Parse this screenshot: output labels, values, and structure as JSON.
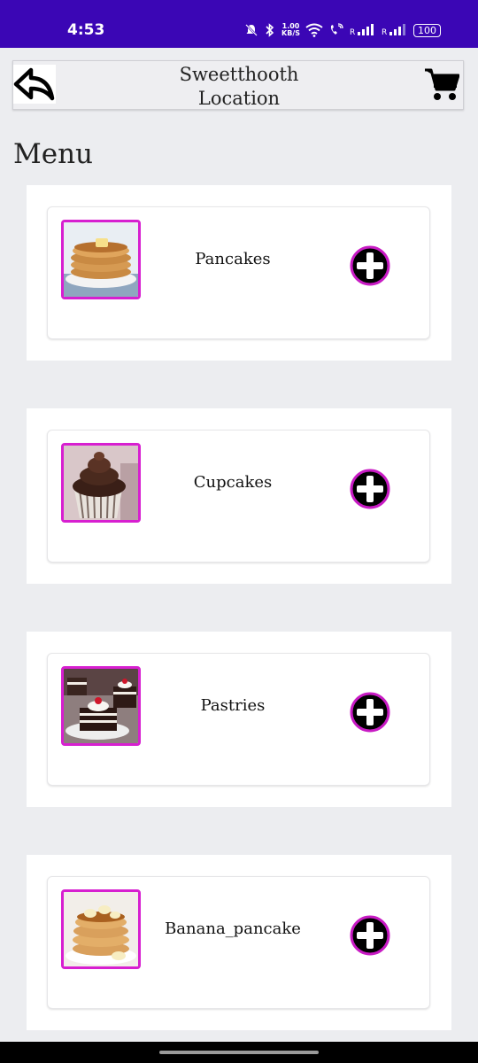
{
  "status_bar": {
    "time": "4:53",
    "net_speed_value": "1.00",
    "net_speed_unit": "KB/S",
    "battery": "100"
  },
  "header": {
    "title_line1": "Sweetthooth",
    "title_line2": "Location",
    "back_icon": "reply-arrow-icon",
    "cart_icon": "shopping-cart-icon"
  },
  "menu": {
    "title": "Menu",
    "items": [
      {
        "name": "Pancakes",
        "image": "pancakes-image"
      },
      {
        "name": "Cupcakes",
        "image": "cupcakes-image"
      },
      {
        "name": "Pastries",
        "image": "pastries-image"
      },
      {
        "name": "Banana_pancake",
        "image": "banana-pancake-image"
      }
    ]
  },
  "colors": {
    "status_bar": "#3B06B5",
    "thumb_border": "#D71FD0",
    "add_button_ring": "#C81BC4",
    "background": "#ECEDF0"
  }
}
